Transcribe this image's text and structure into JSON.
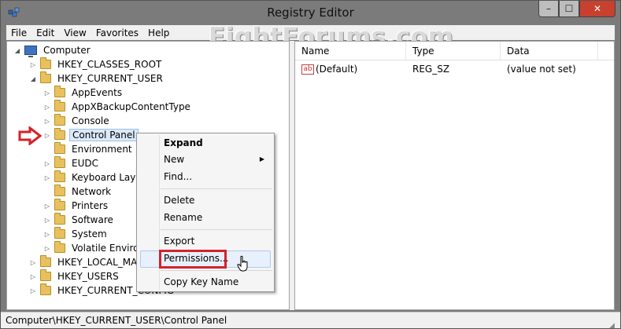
{
  "window": {
    "title": "Registry Editor",
    "controls": {
      "minimize": "–",
      "maximize": "☐",
      "close": "✕"
    }
  },
  "watermark": "EightForums.com",
  "menubar": [
    "File",
    "Edit",
    "View",
    "Favorites",
    "Help"
  ],
  "tree": {
    "root": "Computer",
    "hkcr": "HKEY_CLASSES_ROOT",
    "hkcu": "HKEY_CURRENT_USER",
    "hkcu_children": [
      "AppEvents",
      "AppXBackupContentType",
      "Console",
      "Control Panel",
      "Environment",
      "EUDC",
      "Keyboard Layout",
      "Network",
      "Printers",
      "Software",
      "System",
      "Volatile Environment"
    ],
    "hklm": "HKEY_LOCAL_MACHINE",
    "hku": "HKEY_USERS",
    "hkcc": "HKEY_CURRENT_CONFIG"
  },
  "list": {
    "columns": [
      "Name",
      "Type",
      "Data"
    ],
    "rows": [
      {
        "name": "(Default)",
        "type": "REG_SZ",
        "data": "(value not set)",
        "icon": "ab"
      }
    ]
  },
  "context_menu": {
    "expand": "Expand",
    "new": "New",
    "find": "Find...",
    "delete": "Delete",
    "rename": "Rename",
    "export": "Export",
    "permissions": "Permissions...",
    "copy_key_name": "Copy Key Name"
  },
  "statusbar": "Computer\\HKEY_CURRENT_USER\\Control Panel",
  "colors": {
    "annotation_red": "#d4222a",
    "selection": "#dbe9f9",
    "folder": "#e8c15e"
  }
}
